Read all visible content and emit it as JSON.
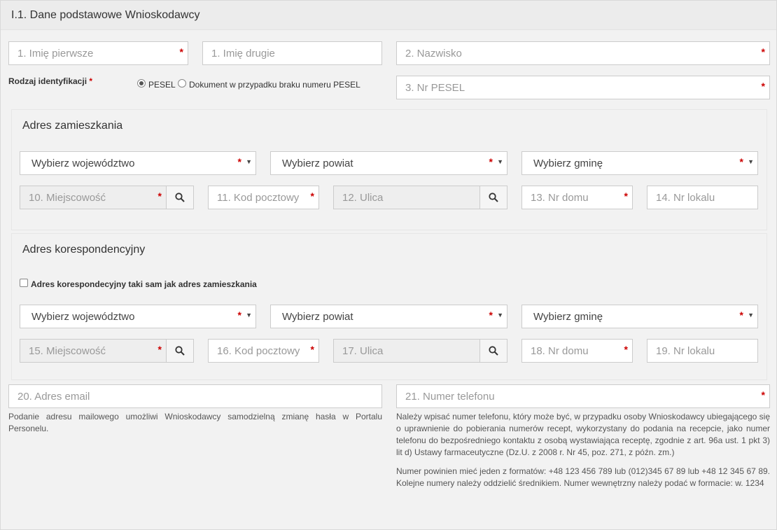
{
  "panel": {
    "title": "I.1. Dane podstawowe Wnioskodawcy"
  },
  "names": {
    "first_name_placeholder": "1. Imię pierwsze",
    "second_name_placeholder": "1. Imię drugie",
    "surname_placeholder": "2. Nazwisko",
    "required_mark": "*"
  },
  "identification": {
    "label": "Rodzaj identyfikacji",
    "required_mark": "*",
    "option_pesel": "PESEL",
    "option_document": "Dokument w przypadku braku numeru PESEL",
    "selected": "PESEL",
    "pesel_placeholder": "3. Nr PESEL"
  },
  "residence": {
    "title": "Adres zamieszkania",
    "voivodeship": "Wybierz województwo",
    "county": "Wybierz powiat",
    "commune": "Wybierz gminę",
    "city_placeholder": "10. Miejscowość",
    "postal_placeholder": "11. Kod pocztowy",
    "street_placeholder": "12. Ulica",
    "house_placeholder": "13. Nr domu",
    "apartment_placeholder": "14. Nr lokalu"
  },
  "correspondence": {
    "title": "Adres korespondencyjny",
    "same_checkbox_label": "Adres korespondecyjny taki sam jak adres zamieszkania",
    "same_checked": false,
    "voivodeship": "Wybierz województwo",
    "county": "Wybierz powiat",
    "commune": "Wybierz gminę",
    "city_placeholder": "15. Miejscowość",
    "postal_placeholder": "16. Kod pocztowy",
    "street_placeholder": "17. Ulica",
    "house_placeholder": "18. Nr domu",
    "apartment_placeholder": "19. Nr lokalu"
  },
  "contact": {
    "email_placeholder": "20. Adres email",
    "phone_placeholder": "21. Numer telefonu",
    "email_help": "Podanie adresu mailowego umożliwi Wnioskodawcy samodzielną zmianę hasła w Portalu Personelu.",
    "phone_help_1": "Należy wpisać numer telefonu, który może być, w przypadku osoby Wnioskodawcy ubiegającego się o uprawnienie do pobierania numerów recept, wykorzystany do podania na recepcie, jako numer telefonu do bezpośredniego kontaktu z osobą wystawiająca receptę, zgodnie z art. 96a ust. 1 pkt 3) lit d) Ustawy farmaceutyczne (Dz.U. z 2008 r. Nr 45, poz. 271, z późn. zm.)",
    "phone_help_2": "Numer powinien mieć jeden z formatów: +48 123 456 789 lub (012)345 67 89 lub +48 12 345 67 89. Kolejne numery należy oddzielić średnikiem. Numer wewnętrzny należy podać w formacie: w. 1234"
  },
  "icons": {
    "search": "search-icon",
    "caret": "chevron-down-icon"
  },
  "colors": {
    "required": "#cc0000",
    "border": "#cccccc",
    "disabled_bg": "#eeeeee"
  }
}
